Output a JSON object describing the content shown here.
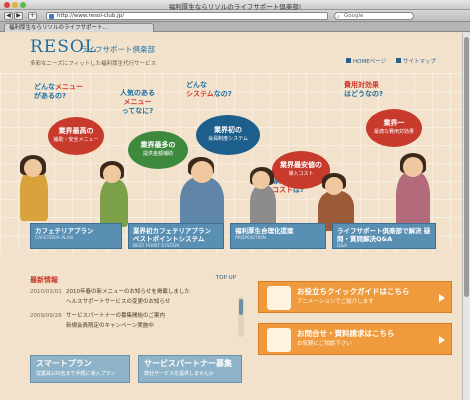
{
  "browser": {
    "window_title": "福利厚生ならリソルのライフサポート倶楽部!",
    "url": "http://www.resol-club.jp/",
    "search_placeholder": "Google",
    "tab_label": "福利厚生ならリソルのライフサポート..."
  },
  "header": {
    "logo": "RESOL",
    "logo_sub": "ライフサポート倶楽部",
    "tagline": "多彩なニーズにフィットした福利厚生代行サービス",
    "link_home": "HOMEページ",
    "link_sitemap": "サイトマップ"
  },
  "hero": {
    "questions": {
      "q1_a": "どんな",
      "q1_b": "メニュー",
      "q1_c": "があるの?",
      "q2_a": "人気のある",
      "q2_b": "メニュー",
      "q2_c": "ってなに?",
      "q3_a": "どんな",
      "q3_b": "システム",
      "q3_c": "なの?",
      "q4_a": "費用対効果",
      "q4_b": "はどうなの?",
      "q5_a": "導入",
      "q5_b": "コスト",
      "q5_c": "は?"
    },
    "bubbles": {
      "b1_title": "業界最高の",
      "b1_sub": "補助・安全メニュー",
      "b2_title": "業界最多の",
      "b2_sub": "提供金額補助",
      "b3_title": "業界初の",
      "b3_sub": "会員制度システム",
      "b4_title": "業界最安値の",
      "b4_sub": "導入コスト",
      "b5_title": "業界一",
      "b5_sub": "最適な費用対効果"
    }
  },
  "categories": [
    {
      "label": "カフェテリアプラン",
      "en": "CAFETERIA PLAN"
    },
    {
      "label": "業界初カフェテリアプラン ベストポイントシステム",
      "en": "BEST POINT SYSTEM"
    },
    {
      "label": "福利厚生合理化提案",
      "en": "PROPOSITION"
    },
    {
      "label": "ライフサポート倶楽部で解決 疑問・質問解決Q&A",
      "en": "Q&A"
    }
  ],
  "news": {
    "title": "最新情報",
    "top_link": "TOP UP",
    "items": [
      {
        "date": "2010/03/01",
        "text": "2010年春の新メニューのお知らせを掲載しました"
      },
      {
        "date": "",
        "text": "ヘルスサポートサービスの変更のお知らせ"
      },
      {
        "date": "2009/09/26",
        "text": "サービスパートナーの募集開始のご案内"
      },
      {
        "date": "",
        "text": "新規会員限定のキャンペーン実施中"
      }
    ]
  },
  "bottom_buttons": {
    "smart_title": "スマートプラン",
    "smart_sub": "従業員100名まで手軽に導入プラン",
    "partner_title": "サービスパートナー募集",
    "partner_sub": "弊社サービスを提供しませんか"
  },
  "promos": {
    "guide_title": "お役立ちクイックガイドはこちら",
    "guide_sub": "アニメーションでご紹介します",
    "contact_title": "お問合せ・資料請求はこちら",
    "contact_sub": "お気軽にご相談下さい"
  }
}
